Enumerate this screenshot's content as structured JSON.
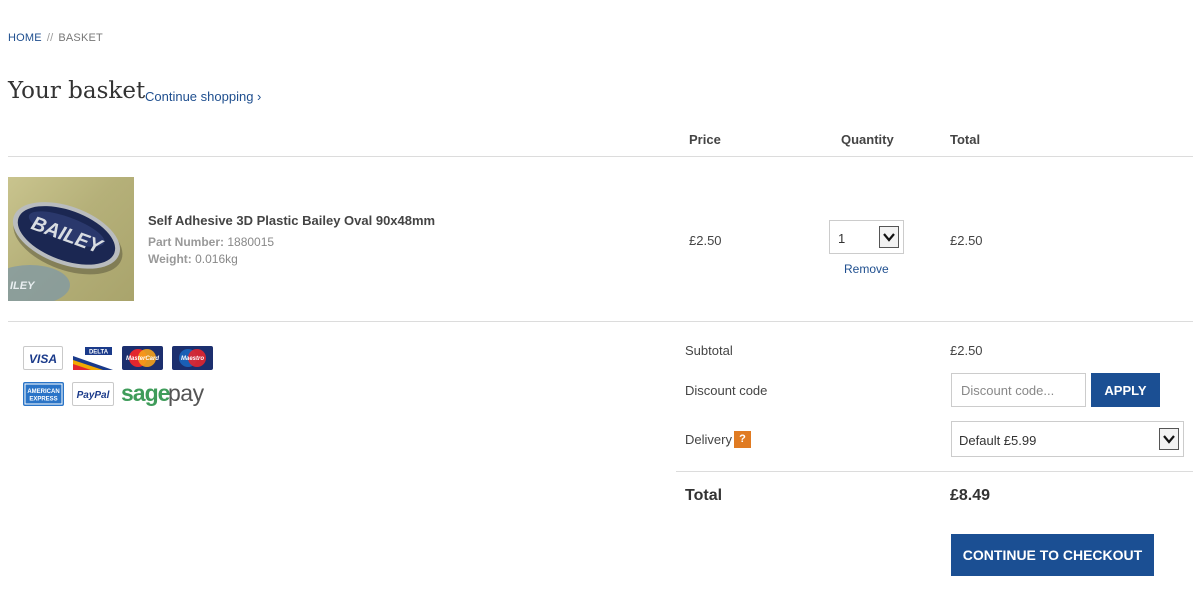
{
  "breadcrumb": {
    "home": "HOME",
    "separator": "//",
    "current": "BASKET"
  },
  "page": {
    "title": "Your basket",
    "continue_shopping": "Continue shopping ›"
  },
  "table": {
    "headers": {
      "price": "Price",
      "quantity": "Quantity",
      "total": "Total"
    }
  },
  "item": {
    "name": "Self Adhesive 3D Plastic Bailey Oval 90x48mm",
    "part_number_label": "Part Number:",
    "part_number": "1880015",
    "weight_label": "Weight:",
    "weight": "0.016kg",
    "image_badge_text": "BAILEY",
    "image_corner_text": "ILEY",
    "price": "£2.50",
    "quantity": "1",
    "remove": "Remove",
    "total": "£2.50"
  },
  "payment_methods": [
    "VISA",
    "DELTA",
    "MasterCard",
    "Maestro",
    "AMERICAN EXPRESS",
    "PayPal",
    "sagepay"
  ],
  "payment_logo_text": {
    "visa": "VISA",
    "delta": "DELTA",
    "mastercard": "MasterCard",
    "maestro": "Maestro",
    "amex_line1": "AMERICAN",
    "amex_line2": "EXPRESS",
    "paypal": "PayPal",
    "sage": "sage",
    "pay": "pay"
  },
  "summary": {
    "subtotal_label": "Subtotal",
    "subtotal_value": "£2.50",
    "discount_label": "Discount code",
    "discount_placeholder": "Discount code...",
    "apply_label": "APPLY",
    "delivery_label": "Delivery",
    "delivery_help": "?",
    "delivery_selected": "Default £5.99",
    "total_label": "Total",
    "total_value": "£8.49",
    "checkout_label": "CONTINUE TO CHECKOUT"
  },
  "colors": {
    "link": "#1f4f8f",
    "button": "#1b4f93",
    "help_badge": "#e07b22",
    "divider": "#dcdcdc",
    "sagepay_green": "#3f9c5a"
  }
}
